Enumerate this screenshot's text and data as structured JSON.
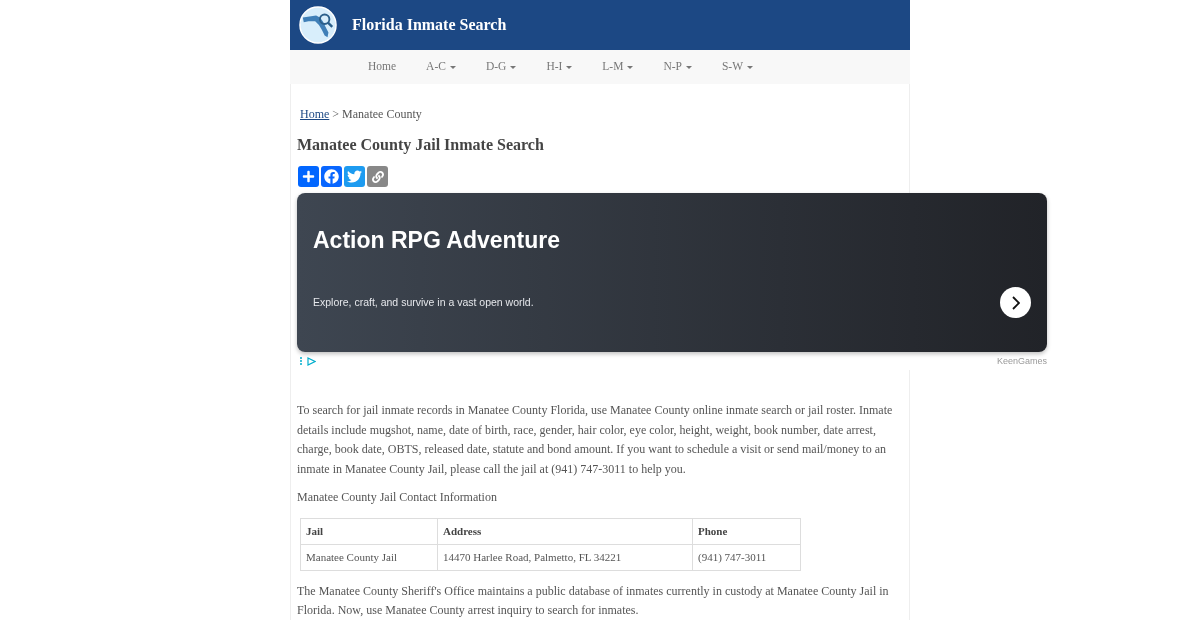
{
  "header": {
    "title": "Florida Inmate Search"
  },
  "nav": [
    {
      "label": "Home",
      "dropdown": false
    },
    {
      "label": "A-C",
      "dropdown": true
    },
    {
      "label": "D-G",
      "dropdown": true
    },
    {
      "label": "H-I",
      "dropdown": true
    },
    {
      "label": "L-M",
      "dropdown": true
    },
    {
      "label": "N-P",
      "dropdown": true
    },
    {
      "label": "S-W",
      "dropdown": true
    }
  ],
  "breadcrumb": {
    "link": "Home",
    "trail": "> Manatee County"
  },
  "page_title": "Manatee County Jail Inmate Search",
  "share_buttons": [
    {
      "kind": "share"
    },
    {
      "kind": "facebook"
    },
    {
      "kind": "twitter"
    },
    {
      "kind": "copy"
    }
  ],
  "ad": {
    "title": "Action RPG Adventure",
    "text": "Explore, craft, and survive in a vast open world.",
    "advertiser": "KeenGames"
  },
  "intro": "To search for jail inmate records in Manatee County Florida, use Manatee County online inmate search or jail roster. Inmate details include mugshot, name, date of birth, race, gender, hair color, eye color, height, weight, book number, date arrest, charge, book date, OBTS, released date, statute and bond amount. If you want to schedule a visit or send mail/money to an inmate in Manatee County Jail, please call the jail at (941) 747-3011 to help you.",
  "contact_heading": "Manatee County Jail Contact Information",
  "table": {
    "columns": [
      "Jail",
      "Address",
      "Phone"
    ],
    "rows": [
      [
        "Manatee County Jail",
        "14470 Harlee Road, Palmetto, FL 34221",
        "(941) 747-3011"
      ]
    ]
  },
  "outro": "The Manatee County Sheriff's Office maintains a public database of inmates currently in custody at Manatee County Jail in Florida. Now, use Manatee County arrest inquiry to search for inmates."
}
